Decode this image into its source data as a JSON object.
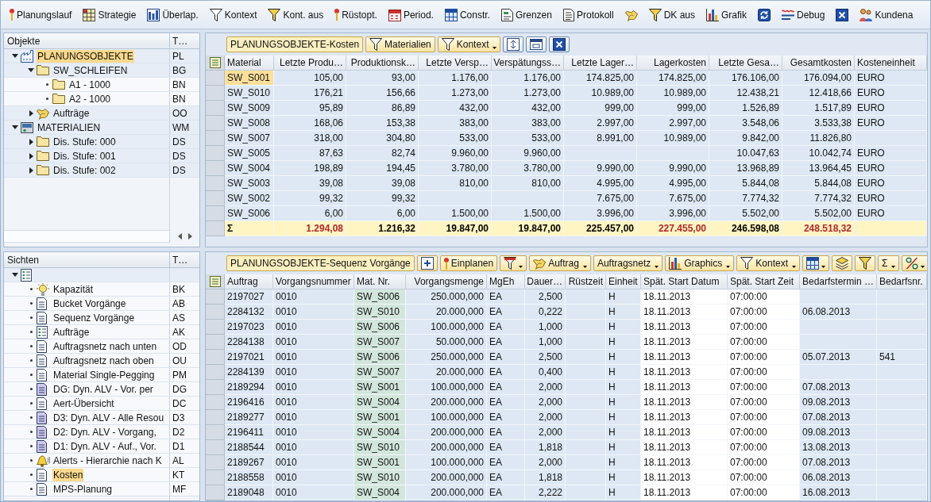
{
  "toolbar": [
    {
      "kind": "button",
      "label": "Planungslauf"
    },
    {
      "kind": "button",
      "label": "Strategie"
    },
    {
      "kind": "button",
      "label": "Überlap."
    },
    {
      "kind": "button",
      "label": "Kontext"
    },
    {
      "kind": "button",
      "label": "Kont. aus"
    },
    {
      "kind": "button",
      "label": "Rüstopt."
    },
    {
      "kind": "button",
      "label": "Period."
    },
    {
      "kind": "button",
      "label": "Constr."
    },
    {
      "kind": "button",
      "label": "Grenzen"
    },
    {
      "kind": "button",
      "label": "Protokoll"
    },
    {
      "kind": "icon_button"
    },
    {
      "kind": "button",
      "label": "DK aus"
    },
    {
      "kind": "button",
      "label": "Grafik"
    },
    {
      "kind": "icon_button"
    },
    {
      "kind": "button",
      "label": "Debug"
    },
    {
      "kind": "icon_button"
    },
    {
      "kind": "button",
      "label": "Kundena"
    }
  ],
  "objects_tree": {
    "columns": [
      "Objekte",
      "T…"
    ],
    "nodes": [
      {
        "label": "PLANUNGSOBJEKTE",
        "type": "PL",
        "kind": "plant",
        "expanded": true,
        "selected": true,
        "children": [
          {
            "label": "SW_SCHLEIFEN",
            "type": "BG",
            "kind": "folder",
            "expanded": true,
            "selected": false,
            "children": [
              {
                "label": "A1 - 1000",
                "type": "BN",
                "kind": "folder",
                "selected": false
              },
              {
                "label": "A2 - 1000",
                "type": "BN",
                "kind": "folder",
                "selected": false
              }
            ]
          },
          {
            "label": "Aufträge",
            "type": "OO",
            "kind": "orders",
            "expanded": false,
            "selected": false
          }
        ]
      },
      {
        "label": "MATERIALIEN",
        "type": "WM",
        "kind": "materials",
        "expanded": true,
        "selected": false,
        "children": [
          {
            "label": "Dis. Stufe: 000",
            "type": "DS",
            "kind": "folder",
            "expanded": false,
            "selected": false
          },
          {
            "label": "Dis. Stufe: 001",
            "type": "DS",
            "kind": "folder",
            "expanded": false,
            "selected": false
          },
          {
            "label": "Dis. Stufe: 002",
            "type": "DS",
            "kind": "folder",
            "expanded": false,
            "selected": false
          }
        ]
      }
    ]
  },
  "views_tree": {
    "columns": [
      "Sichten",
      "T…"
    ],
    "nodes": [
      {
        "kind": "views",
        "expanded": true,
        "children": [
          {
            "label": "Kapazität",
            "type": "BK",
            "kind": "capacity",
            "selected": false
          },
          {
            "label": "Bucket Vorgänge",
            "type": "AB",
            "kind": "view",
            "selected": false
          },
          {
            "label": "Sequenz Vorgänge",
            "type": "AS",
            "kind": "view",
            "selected": false
          },
          {
            "label": "Aufträge",
            "type": "AK",
            "kind": "table_view",
            "selected": false
          },
          {
            "label": "Auftragsnetz nach unten",
            "type": "OD",
            "kind": "view",
            "selected": false
          },
          {
            "label": "Auftragsnetz nach oben",
            "type": "OU",
            "kind": "view",
            "selected": false
          },
          {
            "label": "Material Single-Pegging",
            "type": "PM",
            "kind": "view",
            "selected": false
          },
          {
            "label": "DG: Dyn. ALV - Vor. per",
            "type": "DG",
            "kind": "dynamic_view",
            "selected": false
          },
          {
            "label": "Aert-Übersicht",
            "type": "DC",
            "kind": "view",
            "selected": false
          },
          {
            "label": "D3: Dyn. ALV - Alle Resou",
            "type": "D3",
            "kind": "dynamic_view",
            "selected": false
          },
          {
            "label": "D2: Dyn. ALV - Vorgang,",
            "type": "D2",
            "kind": "dynamic_view",
            "selected": false
          },
          {
            "label": "D1: Dyn. ALV - Auf., Vor.",
            "type": "D1",
            "kind": "dynamic_view",
            "selected": false
          },
          {
            "label": "Alerts - Hierarchie nach K",
            "type": "AL",
            "kind": "alerts",
            "selected": false
          },
          {
            "label": "Kosten",
            "type": "KT",
            "kind": "view",
            "selected": true
          },
          {
            "label": "MPS-Planung",
            "type": "MF",
            "kind": "view",
            "selected": false
          }
        ]
      }
    ]
  },
  "costs_grid": {
    "title": "PLANUNGSOBJEKTE-Kosten",
    "buttons": [
      {
        "kind": "button",
        "label": "Materialien"
      },
      {
        "kind": "menu_button",
        "label": "Kontext"
      },
      {
        "kind": "icon_button"
      },
      {
        "kind": "icon_button"
      },
      {
        "kind": "icon_button"
      }
    ],
    "columns": [
      {
        "label": "Material",
        "kind": "text"
      },
      {
        "label": "Letzte Produ…",
        "kind": "number"
      },
      {
        "label": "Produktionsk…",
        "kind": "number"
      },
      {
        "label": "Letzte Versp…",
        "kind": "number"
      },
      {
        "label": "Verspätungss…",
        "kind": "number"
      },
      {
        "label": "Letzte Lager…",
        "kind": "number"
      },
      {
        "label": "Lagerkosten",
        "kind": "number"
      },
      {
        "label": "Letzte Gesa…",
        "kind": "number"
      },
      {
        "label": "Gesamtkosten",
        "kind": "number"
      },
      {
        "label": "Kosteneinheit",
        "kind": "text"
      }
    ],
    "rows": [
      {
        "selected": true,
        "cells": [
          "SW_S001",
          "105,00",
          "93,00",
          "1.176,00",
          "1.176,00",
          "174.825,00",
          "174.825,00",
          "176.106,00",
          "176.094,00",
          "EURO"
        ]
      },
      {
        "selected": false,
        "cells": [
          "SW_S010",
          "176,21",
          "156,66",
          "1.273,00",
          "1.273,00",
          "10.989,00",
          "10.989,00",
          "12.438,21",
          "12.418,66",
          "EURO"
        ]
      },
      {
        "selected": false,
        "cells": [
          "SW_S009",
          "95,89",
          "86,89",
          "432,00",
          "432,00",
          "999,00",
          "999,00",
          "1.526,89",
          "1.517,89",
          "EURO"
        ]
      },
      {
        "selected": false,
        "cells": [
          "SW_S008",
          "168,06",
          "153,38",
          "383,00",
          "383,00",
          "2.997,00",
          "2.997,00",
          "3.548,06",
          "3.533,38",
          "EURO"
        ]
      },
      {
        "selected": false,
        "cells": [
          "SW_S007",
          "318,00",
          "304,80",
          "533,00",
          "533,00",
          "8.991,00",
          "10.989,00",
          "9.842,00",
          "11.826,80",
          null
        ]
      },
      {
        "selected": false,
        "cells": [
          "SW_S005",
          "87,63",
          "82,74",
          "9.960,00",
          "9.960,00",
          null,
          null,
          "10.047,63",
          "10.042,74",
          "EURO"
        ]
      },
      {
        "selected": false,
        "cells": [
          "SW_S004",
          "198,89",
          "194,45",
          "3.780,00",
          "3.780,00",
          "9.990,00",
          "9.990,00",
          "13.968,89",
          "13.964,45",
          "EURO"
        ]
      },
      {
        "selected": false,
        "cells": [
          "SW_S003",
          "39,08",
          "39,08",
          "810,00",
          "810,00",
          "4.995,00",
          "4.995,00",
          "5.844,08",
          "5.844,08",
          "EURO"
        ]
      },
      {
        "selected": false,
        "cells": [
          "SW_S002",
          "99,32",
          "99,32",
          null,
          null,
          "7.675,00",
          "7.675,00",
          "7.774,32",
          "7.774,32",
          "EURO"
        ]
      },
      {
        "selected": false,
        "cells": [
          "SW_S006",
          "6,00",
          "6,00",
          "1.500,00",
          "1.500,00",
          "3.996,00",
          "3.996,00",
          "5.502,00",
          "5.502,00",
          "EURO"
        ]
      }
    ],
    "totals": {
      "label": "Σ",
      "cells": [
        {
          "value": "1.294,08",
          "color": "#b3272d"
        },
        {
          "value": "1.216,32",
          "color": "#000000"
        },
        {
          "value": "19.847,00",
          "color": "#000000"
        },
        {
          "value": "19.847,00",
          "color": "#000000"
        },
        {
          "value": "225.457,00",
          "color": "#000000"
        },
        {
          "value": "227.455,00",
          "color": "#b3272d"
        },
        {
          "value": "246.598,08",
          "color": "#000000"
        },
        {
          "value": "248.518,32",
          "color": "#b3272d"
        },
        null
      ]
    }
  },
  "operations_grid": {
    "title": "PLANUNGSOBJEKTE-Sequenz Vorgänge",
    "buttons": [
      {
        "kind": "icon_button"
      },
      {
        "kind": "button",
        "label": "Einplanen"
      },
      {
        "kind": "icon_menu_button"
      },
      {
        "kind": "menu_button",
        "label": "Auftrag"
      },
      {
        "kind": "menu_button",
        "label": "Auftragsnetz"
      },
      {
        "kind": "menu_button",
        "label": "Graphics"
      },
      {
        "kind": "menu_button",
        "label": "Kontext"
      },
      {
        "kind": "icon_menu_button"
      },
      {
        "kind": "icon_button"
      },
      {
        "kind": "icon_button"
      },
      {
        "kind": "menu_button",
        "label": "Σ"
      },
      {
        "kind": "icon_menu_button"
      }
    ],
    "columns": [
      {
        "label": "Auftrag",
        "kind": "text"
      },
      {
        "label": "Vorgangsnummer",
        "kind": "text"
      },
      {
        "label": "Mat. Nr.",
        "kind": "key"
      },
      {
        "label": "Vorgangsmenge",
        "kind": "number"
      },
      {
        "label": "MgEh",
        "kind": "text"
      },
      {
        "label": "Dauer…",
        "kind": "number"
      },
      {
        "label": "Rüstzeit",
        "kind": "number"
      },
      {
        "label": "Einheit",
        "kind": "text"
      },
      {
        "label": "Spät. Start Datum",
        "kind": "input"
      },
      {
        "label": "Spät. Start Zeit",
        "kind": "input"
      },
      {
        "label": "Bedarfstermin …",
        "kind": "text"
      },
      {
        "label": "Bedarfsnr.",
        "kind": "text"
      }
    ],
    "rows": [
      {
        "cells": [
          "2197027",
          "0010",
          "SW_S006",
          "250.000,000",
          "EA",
          "2,500",
          null,
          "H",
          "18.11.2013",
          "07:00:00",
          null,
          null
        ]
      },
      {
        "cells": [
          "2284132",
          "0010",
          "SW_S010",
          "20.000,000",
          "EA",
          "0,222",
          null,
          "H",
          "18.11.2013",
          "07:00:00",
          "06.08.2013",
          null
        ]
      },
      {
        "cells": [
          "2197023",
          "0010",
          "SW_S006",
          "100.000,000",
          "EA",
          "1,000",
          null,
          "H",
          "18.11.2013",
          "07:00:00",
          null,
          null
        ]
      },
      {
        "cells": [
          "2284138",
          "0010",
          "SW_S007",
          "50.000,000",
          "EA",
          "1,000",
          null,
          "H",
          "18.11.2013",
          "07:00:00",
          null,
          null
        ]
      },
      {
        "cells": [
          "2197021",
          "0010",
          "SW_S006",
          "250.000,000",
          "EA",
          "2,500",
          null,
          "H",
          "18.11.2013",
          "07:00:00",
          "05.07.2013",
          "541"
        ]
      },
      {
        "cells": [
          "2284139",
          "0010",
          "SW_S007",
          "20.000,000",
          "EA",
          "0,400",
          null,
          "H",
          "18.11.2013",
          "07:00:00",
          null,
          null
        ]
      },
      {
        "cells": [
          "2189294",
          "0010",
          "SW_S001",
          "100.000,000",
          "EA",
          "2,000",
          null,
          "H",
          "18.11.2013",
          "07:00:00",
          "07.08.2013",
          null
        ]
      },
      {
        "cells": [
          "2196416",
          "0010",
          "SW_S004",
          "200.000,000",
          "EA",
          "2,000",
          null,
          "H",
          "18.11.2013",
          "07:00:00",
          "09.08.2013",
          null
        ]
      },
      {
        "cells": [
          "2189277",
          "0010",
          "SW_S001",
          "100.000,000",
          "EA",
          "2,000",
          null,
          "H",
          "18.11.2013",
          "07:00:00",
          "07.08.2013",
          null
        ]
      },
      {
        "cells": [
          "2196411",
          "0010",
          "SW_S004",
          "200.000,000",
          "EA",
          "2,000",
          null,
          "H",
          "18.11.2013",
          "07:00:00",
          "09.08.2013",
          null
        ]
      },
      {
        "cells": [
          "2188544",
          "0010",
          "SW_S010",
          "200.000,000",
          "EA",
          "1,818",
          null,
          "H",
          "18.11.2013",
          "07:00:00",
          "13.08.2013",
          null
        ]
      },
      {
        "cells": [
          "2189267",
          "0010",
          "SW_S001",
          "100.000,000",
          "EA",
          "2,000",
          null,
          "H",
          "18.11.2013",
          "07:00:00",
          "07.08.2013",
          null
        ]
      },
      {
        "cells": [
          "2188558",
          "0010",
          "SW_S010",
          "200.000,000",
          "EA",
          "1,818",
          null,
          "H",
          "18.11.2013",
          "07:00:00",
          "06.08.2013",
          null
        ]
      },
      {
        "cells": [
          "2189048",
          "0010",
          "SW_S004",
          "200.000,000",
          "EA",
          "2,222",
          null,
          "H",
          "18.11.2013",
          "07:00:00",
          "16.08.2013",
          null
        ]
      }
    ]
  }
}
